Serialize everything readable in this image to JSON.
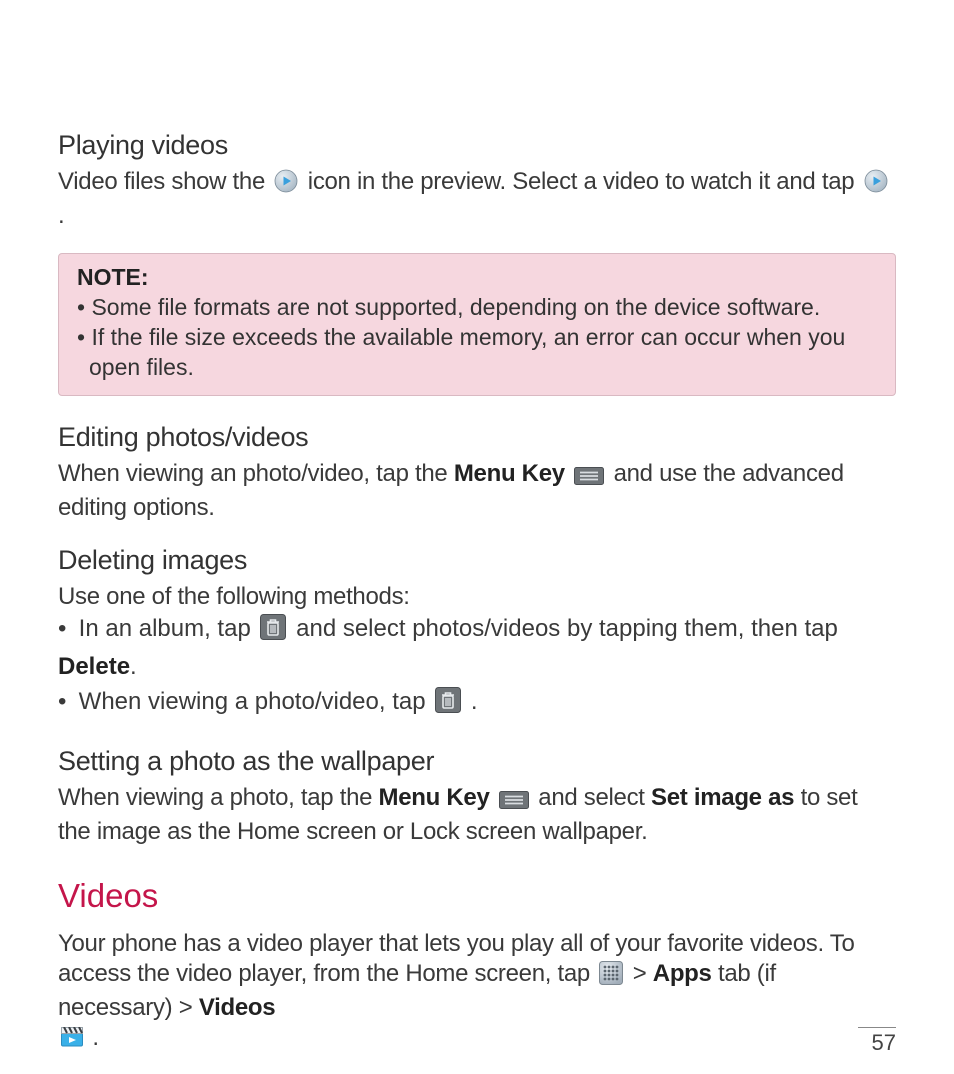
{
  "s1": {
    "heading": "Playing videos",
    "para_a": "Video files show the ",
    "para_b": " icon in the preview. Select a video to watch it and tap ",
    "para_c": "."
  },
  "note": {
    "label": "NOTE:",
    "item1": "Some file formats are not supported, depending on the device software.",
    "item2": "If the file size exceeds the available memory, an error can occur when you open files."
  },
  "s2": {
    "heading": "Editing photos/videos",
    "para_a": "When viewing an photo/video, tap the ",
    "menu_key": "Menu Key",
    "para_b": " and use the advanced editing options."
  },
  "s3": {
    "heading": "Deleting images",
    "intro": "Use one of the following methods:",
    "b1a": "In an album, tap ",
    "b1b": " and select photos/videos by tapping them, then tap ",
    "delete": "Delete",
    "b1c": ".",
    "b2a": "When viewing a photo/video, tap ",
    "b2b": "."
  },
  "s4": {
    "heading": "Setting a photo as the wallpaper",
    "para_a": "When viewing a photo, tap the ",
    "menu_key": "Menu Key",
    "para_b": " and select ",
    "set_image": "Set image as",
    "para_c": " to set the image as the Home screen or Lock screen wallpaper."
  },
  "videos": {
    "heading": "Videos",
    "para_a": "Your phone has a video player that lets you play all of your favorite videos. To access the video player, from the Home screen, tap ",
    "gt1": " > ",
    "apps": "Apps",
    "tab_if": " tab (if necessary) > ",
    "videos_app": "Videos",
    "period": "."
  },
  "page_number": "57"
}
